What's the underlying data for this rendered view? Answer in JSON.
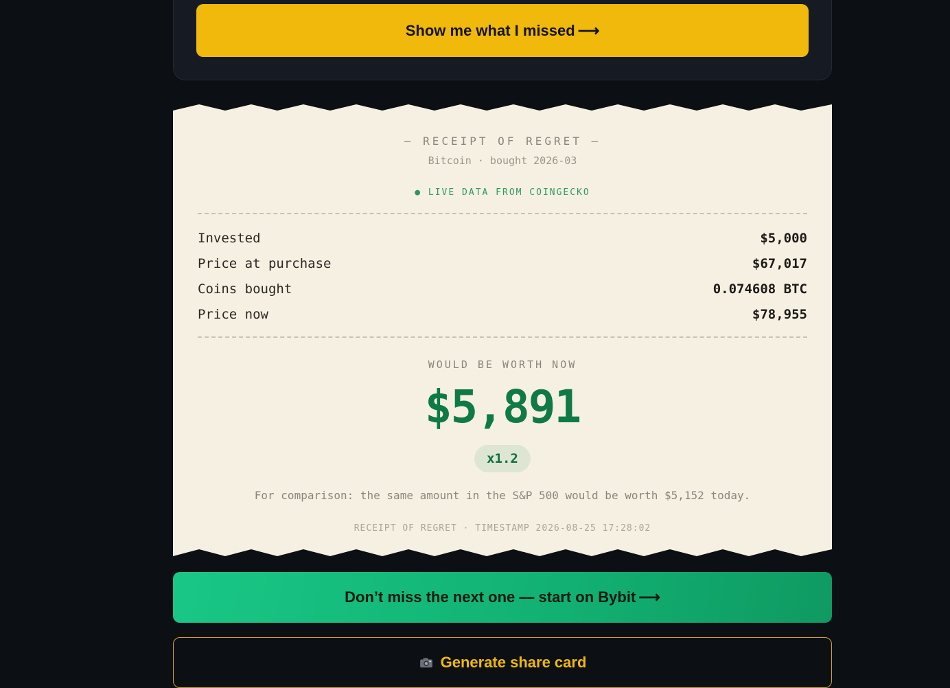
{
  "form": {
    "submit_label": "Show me what I missed",
    "arrow_glyph": "⟶"
  },
  "receipt": {
    "title": "— RECEIPT OF REGRET —",
    "subtitle": "Bitcoin · bought 2026-03",
    "live_badge": "● LIVE DATA FROM COINGECKO",
    "rows": [
      {
        "label": "Invested",
        "value": "$5,000"
      },
      {
        "label": "Price at purchase",
        "value": "$67,017"
      },
      {
        "label": "Coins bought",
        "value": "0.074608 BTC"
      },
      {
        "label": "Price now",
        "value": "$78,955"
      }
    ],
    "worth_label": "WOULD BE WORTH NOW",
    "worth_value": "$5,891",
    "multiplier": "x1.2",
    "comparison": "For comparison: the same amount in the S&P 500 would be worth $5,152 today.",
    "footer_stamp": "RECEIPT OF REGRET · TIMESTAMP 2026-08-25 17:28:02"
  },
  "cta": {
    "bybit_label": "Don’t miss the next one — start on Bybit",
    "arrow_glyph": "⟶",
    "share_label": "Generate share card",
    "share_icon": "camera-icon"
  },
  "colors": {
    "accent_yellow": "#f0b90b",
    "accent_green": "#19c786",
    "paper": "#f6f0e3",
    "worth_green": "#0f7a45",
    "background": "#0c0f14"
  }
}
